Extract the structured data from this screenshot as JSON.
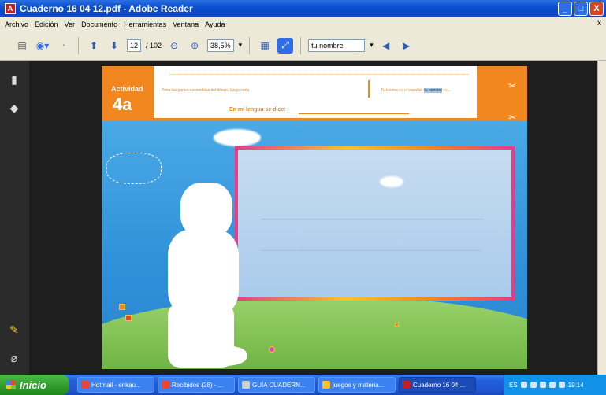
{
  "window": {
    "title": "Cuaderno 16 04 12.pdf - Adobe Reader",
    "controls": [
      "_",
      "□",
      "X"
    ]
  },
  "menu": [
    "Archivo",
    "Edición",
    "Ver",
    "Documento",
    "Herramientas",
    "Ventana",
    "Ayuda"
  ],
  "menu_close": "x",
  "toolbar": {
    "page_current": "12",
    "page_total": "/ 102",
    "zoom": "38,5%",
    "search_value": "tu nombre"
  },
  "document": {
    "activity_label": "Actividad",
    "activity_number": "4a",
    "instruction_left": "Pinta las partes escondidas del dibujo, luego corta",
    "instruction_right_pre": "Tu idioma es el español.",
    "instruction_right_highlight": "tu nombre",
    "instruction_right_post": "es...",
    "lengua_label": "En mi lengua se dice:"
  },
  "taskbar": {
    "start_label": "Inicio",
    "tasks": [
      {
        "label": "Hotmail - enkau...",
        "icon_color": "#f0422e",
        "active": false
      },
      {
        "label": "Recibidos (28) - ...",
        "icon_color": "#f0422e",
        "active": false
      },
      {
        "label": "GUÍA CUADERN...",
        "icon_color": "#d0d0d0",
        "active": false
      },
      {
        "label": "juegos y materia...",
        "icon_color": "#f6c42a",
        "active": false
      },
      {
        "label": "Cuaderno 16 04 ...",
        "icon_color": "#c41e1e",
        "active": true
      }
    ],
    "tray_lang": "ES",
    "clock": "19:14"
  }
}
